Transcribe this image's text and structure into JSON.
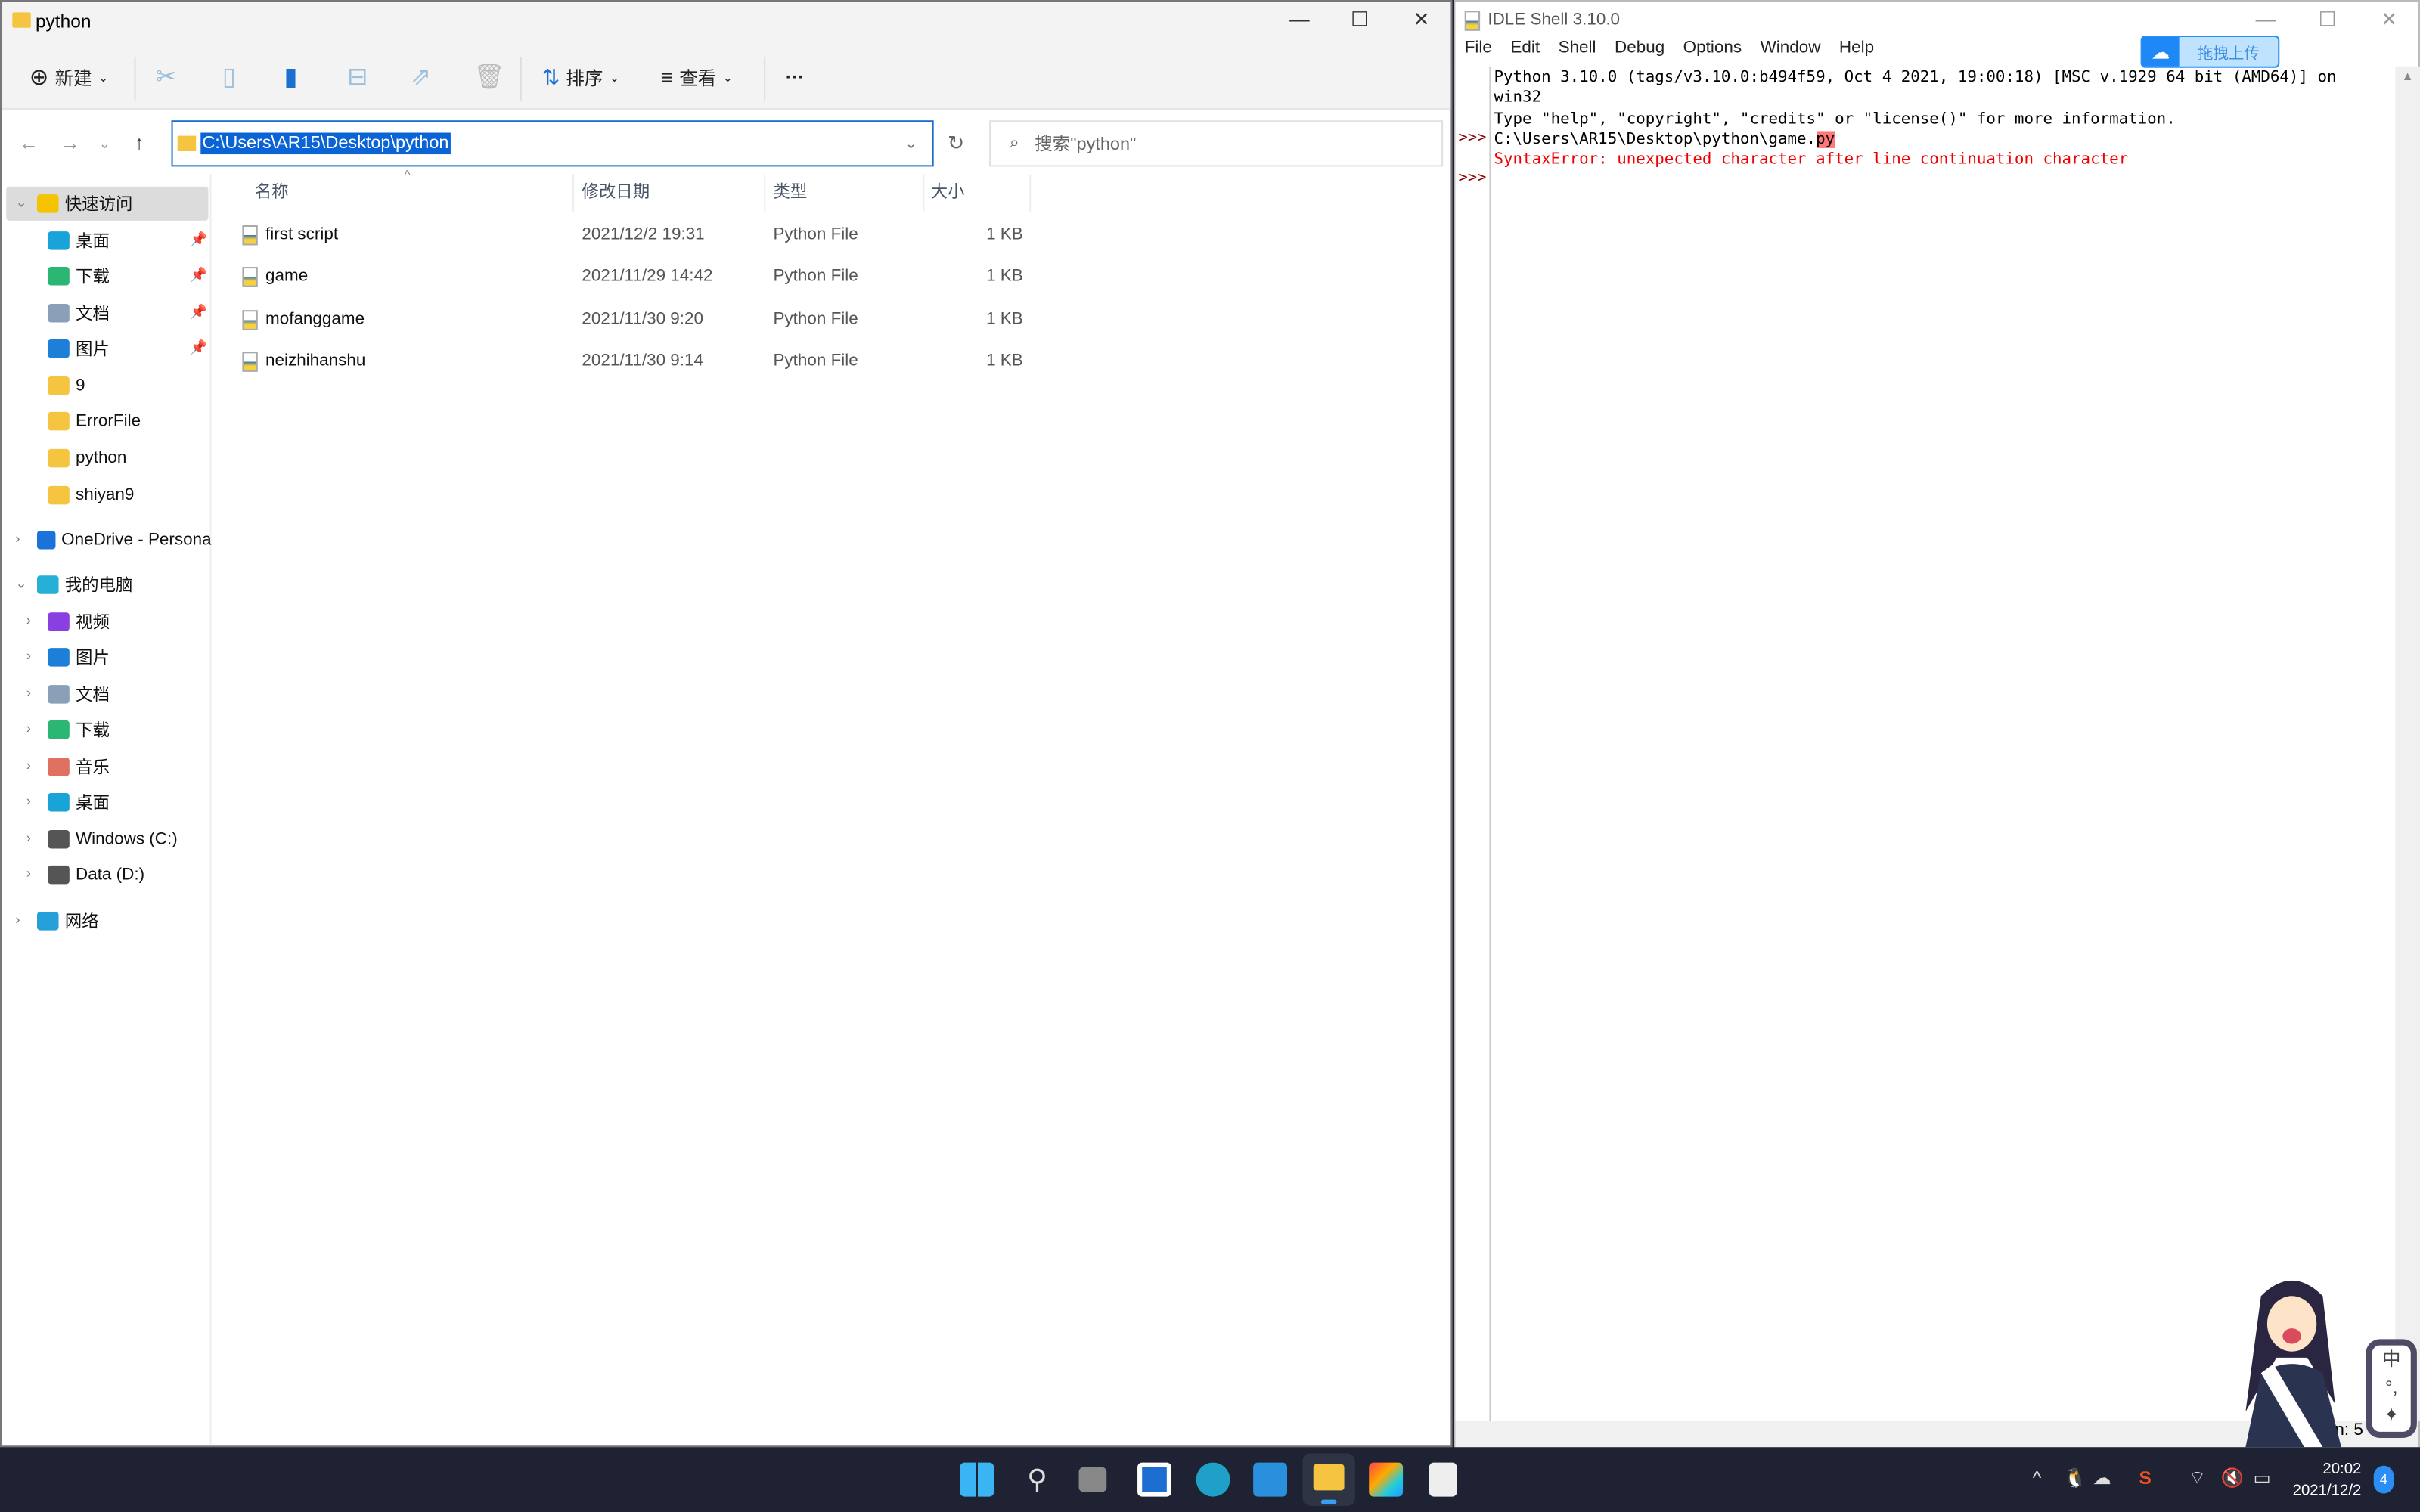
{
  "explorer": {
    "title": "python",
    "toolbar": {
      "new_label": "新建",
      "sort_label": "排序",
      "view_label": "查看",
      "more_label": "···"
    },
    "address": "C:\\Users\\AR15\\Desktop\\python",
    "search_placeholder": "搜索\"python\"",
    "columns": [
      "名称",
      "修改日期",
      "类型",
      "大小"
    ],
    "files": [
      {
        "name": "first script",
        "date": "2021/12/2 19:31",
        "type": "Python File",
        "size": "1 KB"
      },
      {
        "name": "game",
        "date": "2021/11/29 14:42",
        "type": "Python File",
        "size": "1 KB"
      },
      {
        "name": "mofanggame",
        "date": "2021/11/30 9:20",
        "type": "Python File",
        "size": "1 KB"
      },
      {
        "name": "neizhihanshu",
        "date": "2021/11/30 9:14",
        "type": "Python File",
        "size": "1 KB"
      }
    ],
    "sidebar": [
      {
        "label": "快速访问",
        "level": 0,
        "chev": "⌄",
        "color": "#f5c400"
      },
      {
        "label": "桌面",
        "level": 1,
        "pin": true,
        "color": "#1aa3d8"
      },
      {
        "label": "下载",
        "level": 1,
        "pin": true,
        "color": "#2bb673"
      },
      {
        "label": "文档",
        "level": 1,
        "pin": true,
        "color": "#8aa0b8"
      },
      {
        "label": "图片",
        "level": 1,
        "pin": true,
        "color": "#1e7fd8"
      },
      {
        "label": "9",
        "level": 1,
        "color": "#f5c542"
      },
      {
        "label": "ErrorFile",
        "level": 1,
        "color": "#f5c542"
      },
      {
        "label": "python",
        "level": 1,
        "color": "#f5c542"
      },
      {
        "label": "shiyan9",
        "level": 1,
        "color": "#f5c542"
      },
      {
        "label": "OneDrive - Persona",
        "level": 0,
        "chev": "›",
        "color": "#1a73d8"
      },
      {
        "label": "我的电脑",
        "level": 0,
        "chev": "⌄",
        "color": "#26b0d8"
      },
      {
        "label": "视频",
        "level": 1,
        "chev": "›",
        "color": "#8a3fe0"
      },
      {
        "label": "图片",
        "level": 1,
        "chev": "›",
        "color": "#1e7fd8"
      },
      {
        "label": "文档",
        "level": 1,
        "chev": "›",
        "color": "#8aa0b8"
      },
      {
        "label": "下载",
        "level": 1,
        "chev": "›",
        "color": "#2bb673"
      },
      {
        "label": "音乐",
        "level": 1,
        "chev": "›",
        "color": "#e07060"
      },
      {
        "label": "桌面",
        "level": 1,
        "chev": "›",
        "color": "#1aa3d8"
      },
      {
        "label": "Windows (C:)",
        "level": 1,
        "chev": "›",
        "color": "#555"
      },
      {
        "label": "Data (D:)",
        "level": 1,
        "chev": "›",
        "color": "#555"
      },
      {
        "label": "网络",
        "level": 0,
        "chev": "›",
        "color": "#26a0d8"
      }
    ]
  },
  "idle": {
    "title": "IDLE Shell 3.10.0",
    "menu": [
      "File",
      "Edit",
      "Shell",
      "Debug",
      "Options",
      "Window",
      "Help"
    ],
    "lines": {
      "l1": "Python 3.10.0 (tags/v3.10.0:b494f59, Oct  4 2021, 19:00:18) [MSC v.1929 64 bit (AMD64)] on",
      "l2": "win32",
      "l3": "Type \"help\", \"copyright\", \"credits\" or \"license()\" for more information.",
      "l4a": "C:\\Users\\AR15\\Desktop\\python\\game.",
      "l4b": "py",
      "l5": "SyntaxError: unexpected character after line continuation character"
    },
    "prompt": ">>>",
    "status": "Ln: 5  Col: 0"
  },
  "upload_widget": {
    "label": "拖拽上传"
  },
  "ime": {
    "mode": "中",
    "punct": "°,"
  },
  "taskbar": {
    "time": "20:02",
    "date": "2021/12/2",
    "notifications": "4",
    "tray_chevron": "^"
  },
  "colors": {
    "accent": "#0a64d6",
    "error": "#ee0000",
    "taskbar": "#1e2232"
  }
}
